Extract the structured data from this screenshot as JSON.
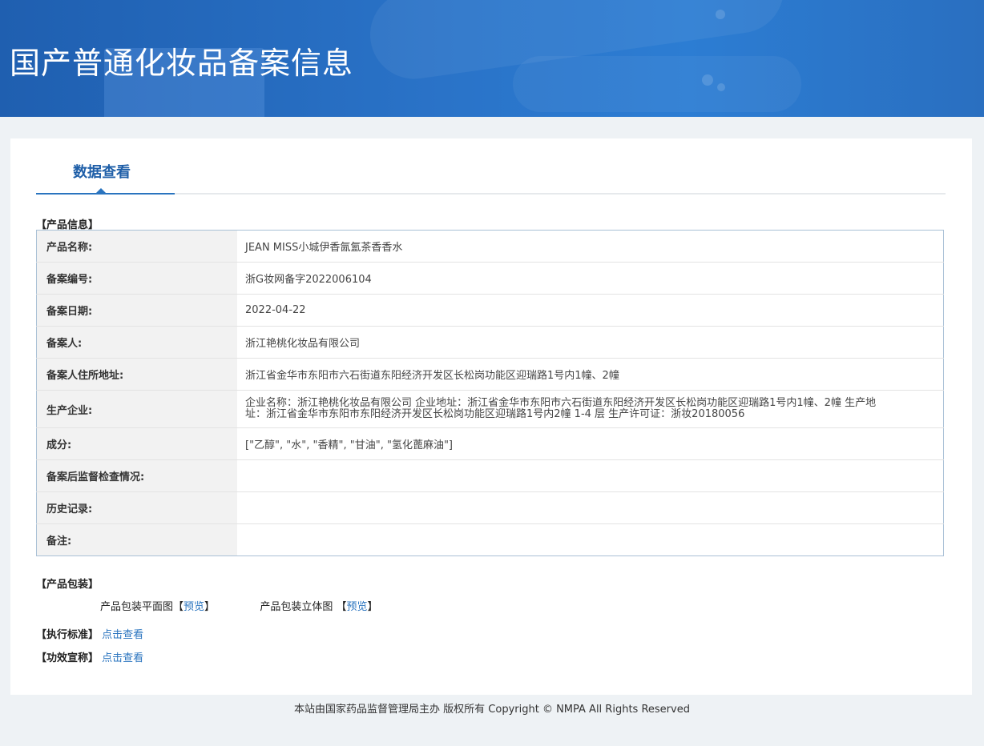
{
  "header": {
    "title": "国产普通化妆品备案信息"
  },
  "tab": {
    "label": "数据查看"
  },
  "product_info": {
    "section_label": "【产品信息】",
    "rows": [
      {
        "key": "产品名称:",
        "value": "JEAN MISS小城伊香氤氳茶香香水"
      },
      {
        "key": "备案编号:",
        "value": "浙G妆网备字2022006104"
      },
      {
        "key": "备案日期:",
        "value": "2022-04-22"
      },
      {
        "key": "备案人:",
        "value": "浙江艳桃化妆品有限公司"
      },
      {
        "key": "备案人住所地址:",
        "value": "浙江省金华市东阳市六石街道东阳经济开发区长松岗功能区迎瑞路1号内1幢、2幢"
      },
      {
        "key": "生产企业:",
        "value": "企业名称：浙江艳桃化妆品有限公司 企业地址：浙江省金华市东阳市六石街道东阳经济开发区长松岗功能区迎瑞路1号内1幢、2幢 生产地址：浙江省金华市东阳市东阳经济开发区长松岗功能区迎瑞路1号内2幢 1-4 层 生产许可证：浙妆20180056"
      },
      {
        "key": "成分:",
        "value": "[\"乙醇\", \"水\", \"香精\", \"甘油\", \"氢化蓖麻油\"]"
      },
      {
        "key": "备案后监督检查情况:",
        "value": ""
      },
      {
        "key": "历史记录:",
        "value": ""
      },
      {
        "key": "备注:",
        "value": ""
      }
    ]
  },
  "packaging": {
    "section_label": "【产品包装】",
    "flat_label": "产品包装平面图",
    "flat_bracket_open": "【",
    "flat_link": "预览",
    "flat_bracket_close": "】",
    "solid_label": "产品包装立体图",
    "solid_bracket_open": "【",
    "solid_link": "预览",
    "solid_bracket_close": "】"
  },
  "standard": {
    "section_label": "【执行标准】",
    "link": "点击查看"
  },
  "efficacy": {
    "section_label": "【功效宣称】",
    "link": "点击查看"
  },
  "footer": {
    "text": "本站由国家药品监督管理局主办 版权所有 Copyright © NMPA All Rights Reserved"
  }
}
